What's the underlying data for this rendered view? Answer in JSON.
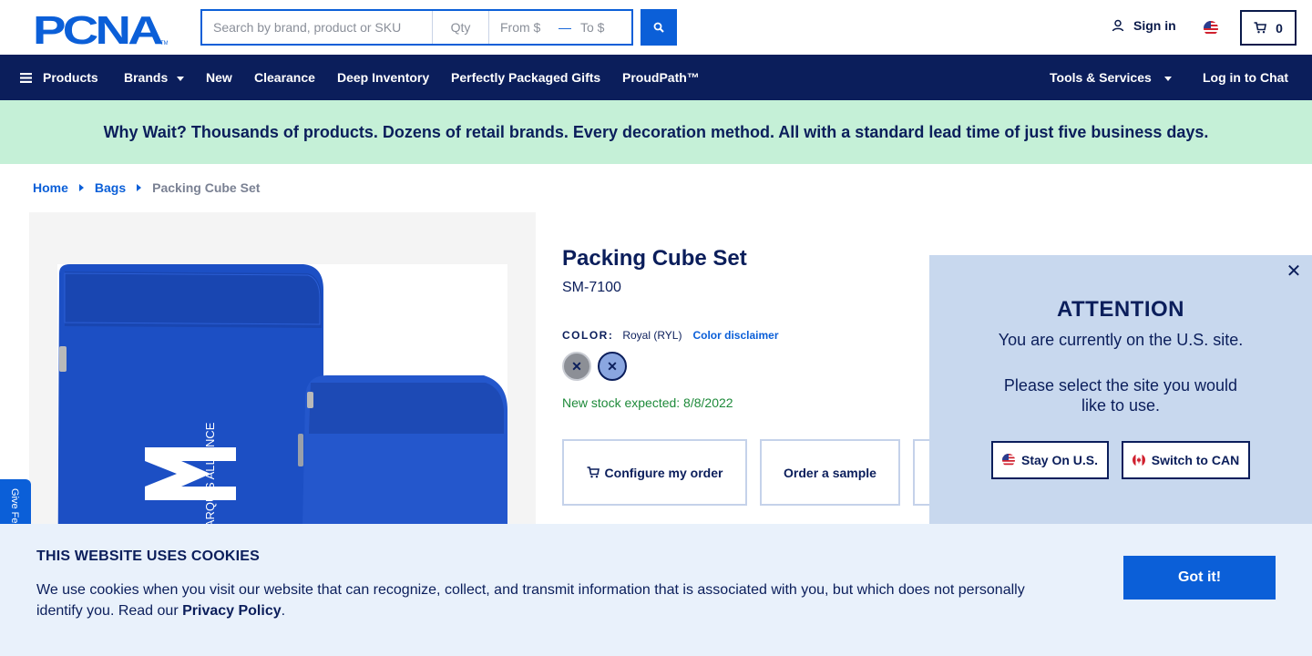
{
  "header": {
    "logo_text": "PCNA",
    "search_placeholder": "Search by brand, product or SKU",
    "qty_placeholder": "Qty",
    "from_placeholder": "From $",
    "to_placeholder": "To $",
    "sign_in": "Sign in",
    "cart_count": "0"
  },
  "nav": {
    "products": "Products",
    "brands": "Brands",
    "new": "New",
    "clearance": "Clearance",
    "deep_inventory": "Deep Inventory",
    "gifts": "Perfectly Packaged Gifts",
    "proudpath": "ProudPath™",
    "tools": "Tools & Services",
    "chat": "Log in to Chat"
  },
  "promo": "Why Wait? Thousands of products. Dozens of retail brands. Every decoration method. All with a standard lead time of just five business days.",
  "breadcrumb": {
    "home": "Home",
    "bags": "Bags",
    "current": "Packing Cube Set"
  },
  "product": {
    "title": "Packing Cube Set",
    "sku": "SM-7100",
    "color_label": "COLOR:",
    "color_value": "Royal (RYL)",
    "color_disclaimer": "Color disclaimer",
    "stock": "New stock expected: 8/8/2022",
    "configure": "Configure my order",
    "sample": "Order a sample",
    "image_brand_text": "MARQUIS ALLIANCE",
    "image_color": "#1c4fc4"
  },
  "feedback": "Give Fe",
  "attention": {
    "title": "ATTENTION",
    "line1": "You are currently on the U.S. site.",
    "line2": "Please select the site you would like to use.",
    "stay": "Stay On U.S.",
    "switch": "Switch to CAN"
  },
  "cookie": {
    "title": "THIS WEBSITE USES COOKIES",
    "text": "We use cookies when you visit our website that can recognize, collect, and transmit information that is associated with you, but which does not personally identify you. Read our ",
    "link": "Privacy Policy",
    "end": ".",
    "button": "Got it!"
  },
  "colors": {
    "brand_blue": "#0b5fd8",
    "navy": "#0b1e5b",
    "promo_green": "#c5f0d7",
    "stock_green": "#1e8a3a"
  }
}
